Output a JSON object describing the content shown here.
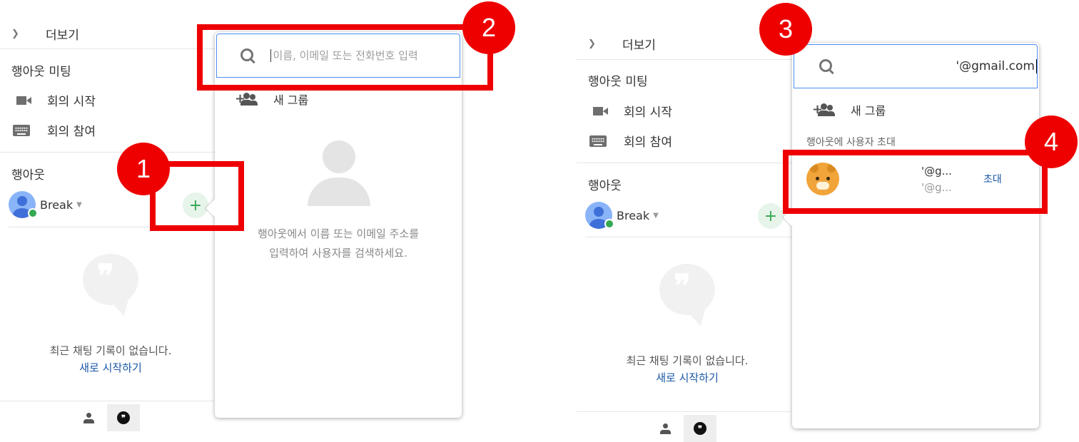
{
  "colors": {
    "accent_red": "#ee0000",
    "link_blue": "#1a57a5",
    "online_green": "#34a853",
    "search_border": "#4c8bf5"
  },
  "icons": {
    "chevron": "chevron-down-icon",
    "video": "video-camera-icon",
    "keyboard": "keyboard-icon",
    "add": "plus-icon",
    "search": "search-icon",
    "group": "add-group-icon",
    "people_tab": "person-icon",
    "chat_tab": "hangouts-chat-icon"
  },
  "left": {
    "more": "더보기",
    "meet_title": "행아웃 미팅",
    "start_meeting": "회의 시작",
    "join_meeting": "회의 참여",
    "hangouts_title": "행아웃",
    "user_name": "Break",
    "add_button": "+",
    "empty_quote": "❞",
    "empty_text": "최근 채팅 기록이 없습니다.",
    "new_start": "새로 시작하기"
  },
  "left_popup": {
    "search_placeholder": "이름, 이메일 또는 전화번호 입력",
    "new_group": "새 그룹",
    "hint_line1": "행아웃에서 이름 또는 이메일 주소를",
    "hint_line2": "입력하여 사용자를 검색하세요."
  },
  "right": {
    "more": "더보기",
    "meet_title": "행아웃 미팅",
    "start_meeting": "회의 시작",
    "join_meeting": "회의 참여",
    "hangouts_title": "행아웃",
    "user_name": "Break",
    "add_button": "+",
    "empty_quote": "❞",
    "empty_text": "최근 채팅 기록이 없습니다.",
    "new_start": "새로 시작하기"
  },
  "right_popup": {
    "search_value": "'@gmail.com",
    "new_group": "새 그룹",
    "invite_label": "행아웃에 사용자 초대",
    "contact_name": "'@g...",
    "contact_email": "'@g...",
    "invite_button": "초대"
  },
  "callouts": [
    "1",
    "2",
    "3",
    "4"
  ],
  "bottom_tabs": {
    "chat_glyph": "❞"
  }
}
